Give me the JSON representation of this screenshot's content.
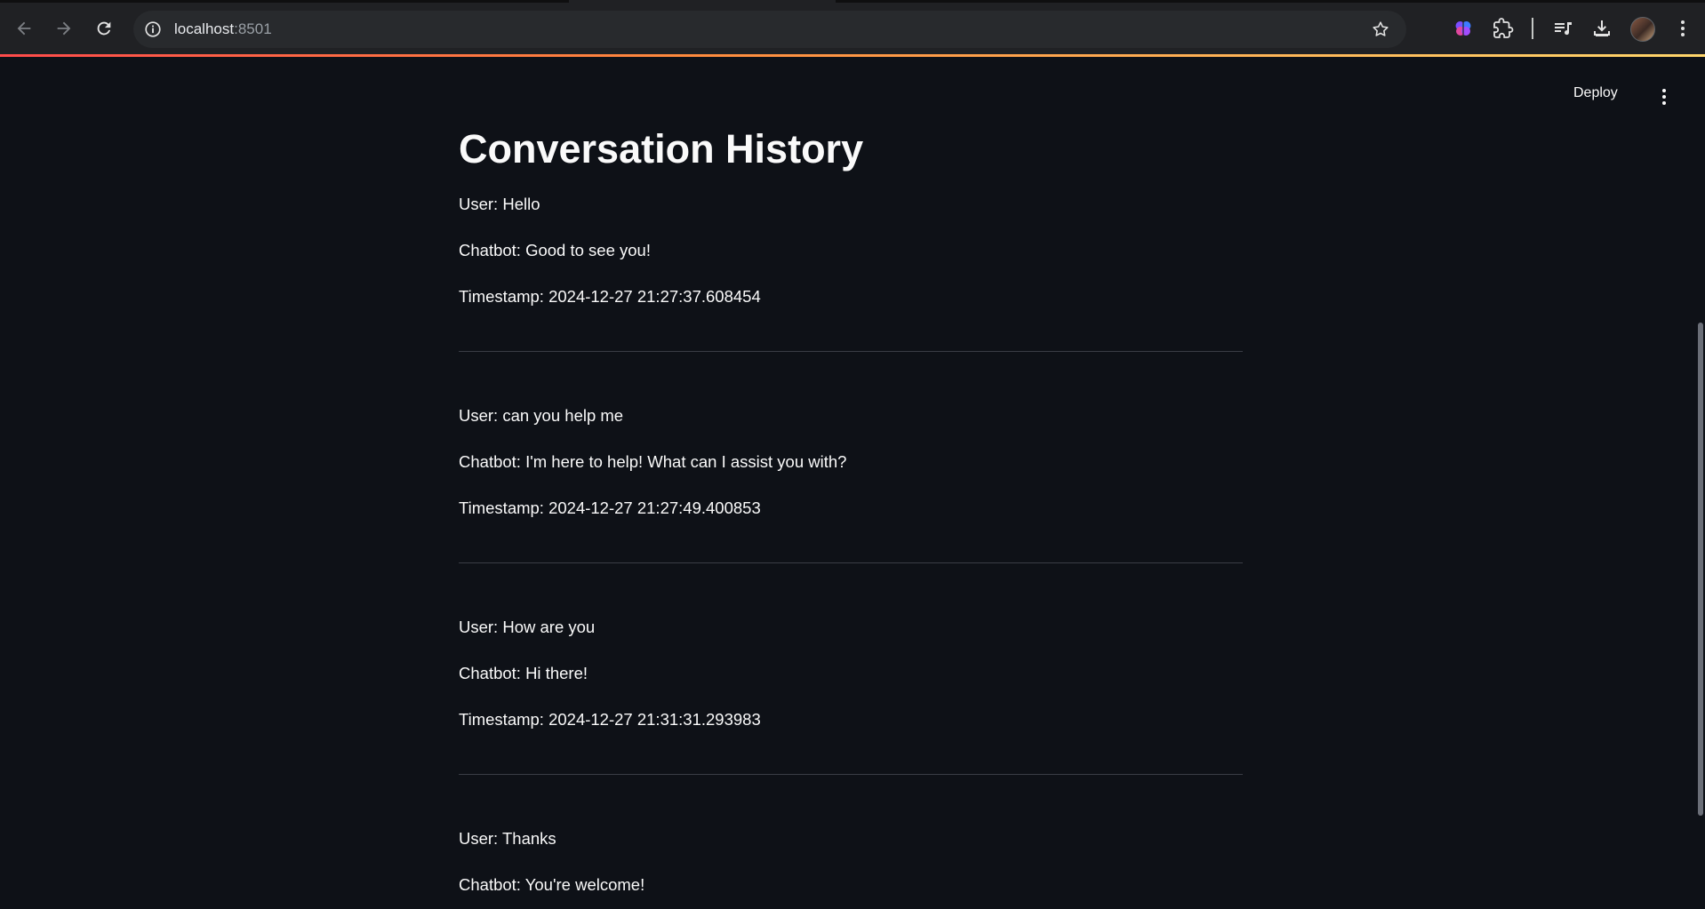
{
  "browser": {
    "url_host": "localhost",
    "url_port": ":8501",
    "icons": [
      "back-arrow-icon",
      "forward-arrow-icon",
      "reload-icon",
      "site-info-icon",
      "bookmark-star-icon",
      "brain-extension-icon",
      "puzzle-extensions-icon",
      "media-queue-icon",
      "download-icon",
      "profile-avatar",
      "kebab-menu-icon"
    ]
  },
  "app_header": {
    "deploy_label": "Deploy"
  },
  "page": {
    "title": "Conversation History"
  },
  "conversation": [
    {
      "user": "User: Hello",
      "bot": "Chatbot: Good to see you!",
      "timestamp": "Timestamp: 2024-12-27 21:27:37.608454"
    },
    {
      "user": "User: can you help me",
      "bot": "Chatbot: I'm here to help! What can I assist you with?",
      "timestamp": "Timestamp: 2024-12-27 21:27:49.400853"
    },
    {
      "user": "User: How are you",
      "bot": "Chatbot: Hi there!",
      "timestamp": "Timestamp: 2024-12-27 21:31:31.293983"
    },
    {
      "user": "User: Thanks",
      "bot": "Chatbot: You're welcome!",
      "timestamp": ""
    }
  ],
  "colors": {
    "background": "#0e1117",
    "text": "#fafafa",
    "divider": "#3a3d45",
    "accent_gradient_start": "#ff4b4b",
    "accent_gradient_end": "#ffd66b"
  }
}
